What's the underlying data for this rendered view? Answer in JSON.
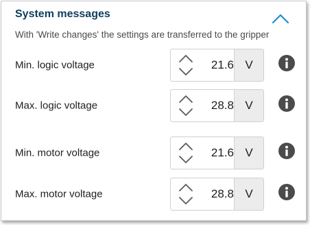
{
  "section": {
    "title": "System messages",
    "subtitle": "With 'Write changes' the settings are transferred to the gripper"
  },
  "rows": [
    {
      "label": "Min. logic voltage",
      "value": "21.6",
      "unit": "V"
    },
    {
      "label": "Max. logic voltage",
      "value": "28.8",
      "unit": "V"
    },
    {
      "label": "Min. motor voltage",
      "value": "21.6",
      "unit": "V"
    },
    {
      "label": "Max. motor voltage",
      "value": "28.8",
      "unit": "V"
    }
  ],
  "icons": {
    "collapse": "chevron-up-icon",
    "stepper_up": "chevron-up-icon",
    "stepper_down": "chevron-down-icon",
    "info": "info-icon"
  },
  "colors": {
    "title": "#0f3d5f",
    "accent": "#1a8fc9",
    "unit_bg": "#ececec",
    "info_bg": "#4b4b4b"
  }
}
